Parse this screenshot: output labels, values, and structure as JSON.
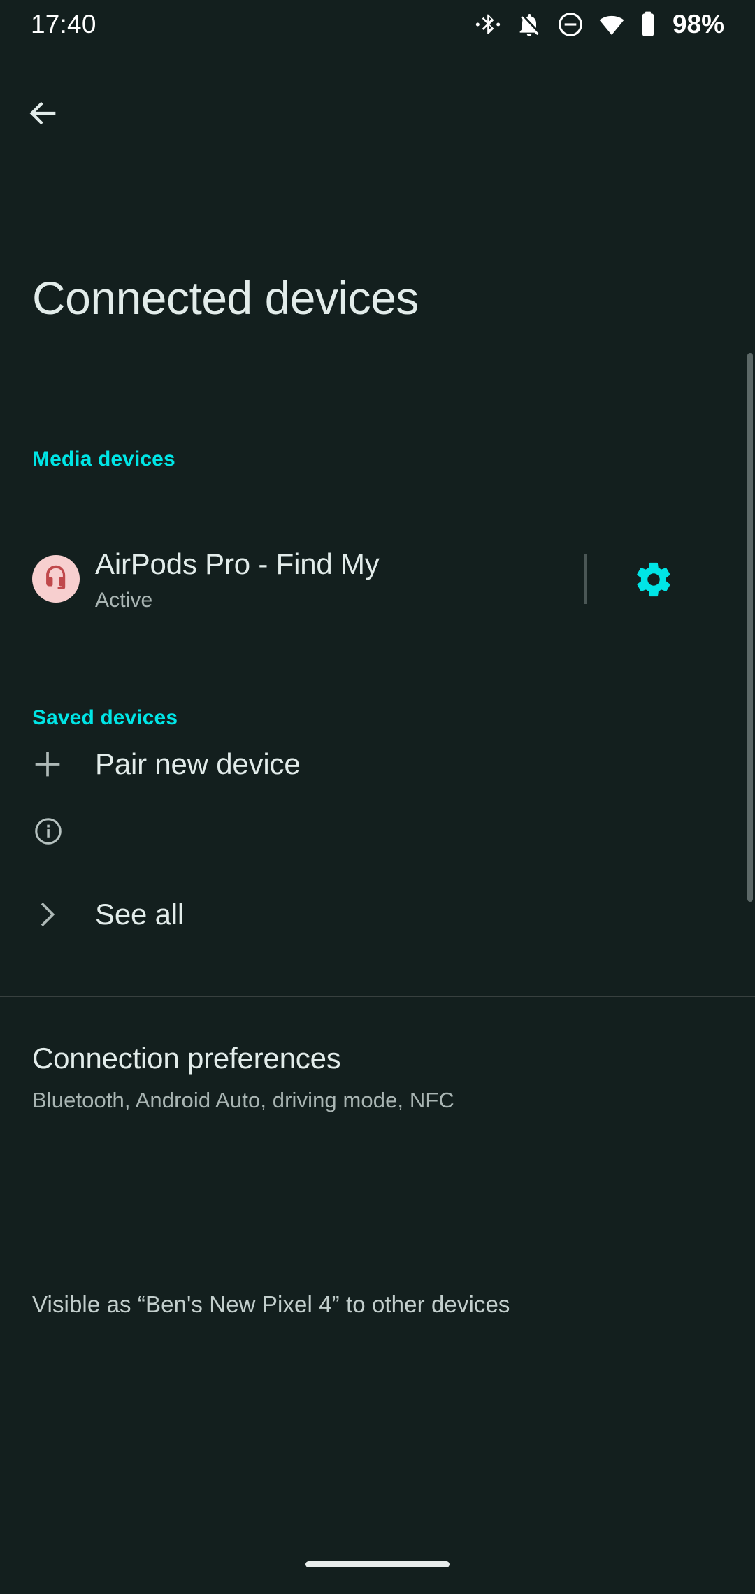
{
  "status_bar": {
    "time": "17:40",
    "battery_percent": "98%",
    "icons": [
      "bluetooth-connected-icon",
      "notifications-off-icon",
      "do-not-disturb-icon",
      "wifi-icon",
      "battery-icon"
    ]
  },
  "nav": {
    "back_label": "Back",
    "back_icon": "arrow-left-icon"
  },
  "header": {
    "title": "Connected devices"
  },
  "sections": {
    "media_devices": {
      "header": "Media devices",
      "device": {
        "name": "AirPods Pro - Find My",
        "status": "Active",
        "avatar_icon": "headset-icon",
        "avatar_bg": "#F7CFCF",
        "avatar_fg": "#C0484B",
        "settings_icon": "gear-icon"
      },
      "pair_new_device": {
        "label": "Pair new device",
        "icon": "plus-icon"
      }
    },
    "saved_devices": {
      "header": "Saved devices",
      "see_all": {
        "label": "See all",
        "icon": "chevron-right-icon"
      }
    },
    "connection_preferences": {
      "title": "Connection preferences",
      "subtitle": "Bluetooth, Android Auto, driving mode, NFC"
    },
    "visibility": {
      "icon": "info-icon",
      "text": "Visible as “Ben's New Pixel 4” to other devices"
    }
  },
  "colors": {
    "background": "#131F1E",
    "accent_cyan": "#00E5E6",
    "text_primary": "#E2ECEA",
    "text_secondary": "#A9B5B3",
    "divider": "#38403F"
  }
}
